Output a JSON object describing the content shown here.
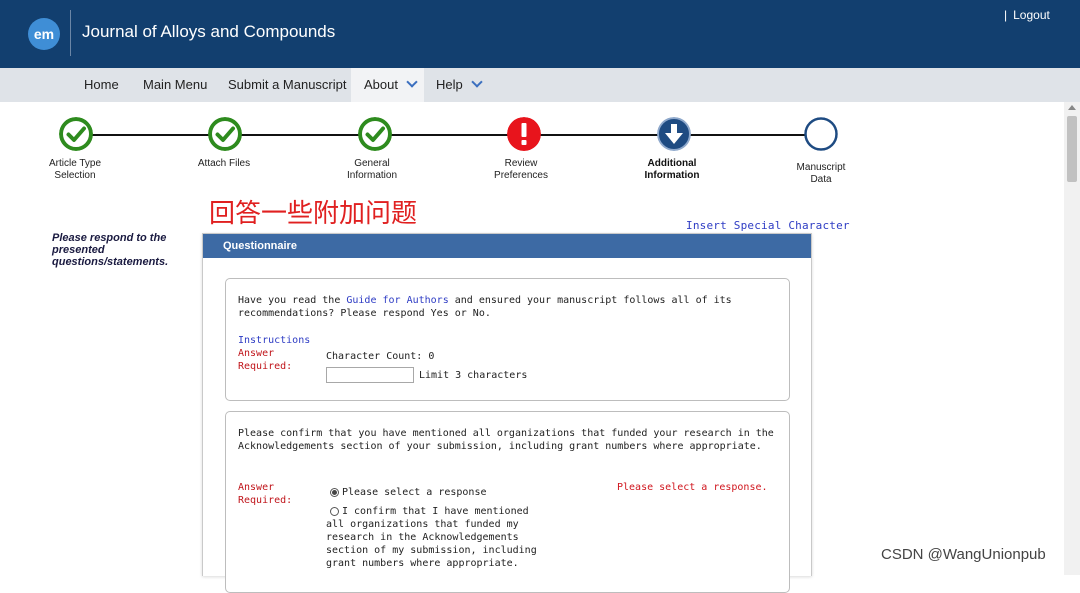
{
  "header": {
    "logo_text": "em",
    "journal_title": "Journal of Alloys and Compounds",
    "logout_separator": "|",
    "logout_label": "Logout"
  },
  "nav": {
    "home": "Home",
    "main_menu": "Main Menu",
    "submit": "Submit a Manuscript",
    "about": "About",
    "help": "Help"
  },
  "steps": [
    {
      "label": "Article Type Selection",
      "state": "complete"
    },
    {
      "label": "Attach Files",
      "state": "complete"
    },
    {
      "label": "General Information",
      "state": "complete"
    },
    {
      "label": "Review Preferences",
      "state": "error"
    },
    {
      "label": "Additional Information",
      "state": "current"
    },
    {
      "label": "Manuscript Data",
      "state": "pending"
    }
  ],
  "annotation": "回答一些附加问题",
  "insert_special": "Insert Special Character",
  "left_prompt": "Please respond to the presented questions/statements.",
  "questionnaire": {
    "title": "Questionnaire",
    "q1": {
      "text_before": "Have you read the ",
      "link": "Guide for Authors",
      "text_after": " and ensured your manuscript follows all of its recommendations? Please respond Yes or No.",
      "instructions": "Instructions",
      "answer_required": "Answer Required:",
      "char_count": "Character Count: 0",
      "input_value": "",
      "limit": "Limit 3 characters"
    },
    "q2": {
      "text": "Please confirm that you have mentioned all organizations that funded your research in the Acknowledgements section of your submission, including grant numbers where appropriate.",
      "answer_required": "Answer Required:",
      "option1": "Please select a response",
      "option2": "I confirm that I have mentioned all organizations that funded my research in the Acknowledgements section of my submission, including grant numbers where appropriate.",
      "error": "Please select a response."
    }
  },
  "watermark": "CSDN @WangUnionpub",
  "colors": {
    "header_bg": "#123f6f",
    "nav_bg": "#dfe3e8",
    "panel_header": "#3d6aa4",
    "complete_green": "#2e8b1e",
    "error_red": "#e8141c",
    "current_navy": "#1e4b82",
    "required_red": "#c0151b",
    "link_blue": "#2e3cc4"
  }
}
